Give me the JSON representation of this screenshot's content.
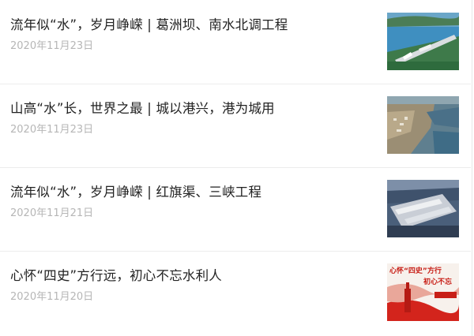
{
  "articles": [
    {
      "title": "流年似“水”，岁月峥嵘 | 葛洲坝、南水北调工程",
      "date": "2020年11月23日",
      "thumbnail": "dam-aerial-image"
    },
    {
      "title": "山高“水”长，世界之最 | 城以港兴，港为城用",
      "date": "2020年11月23日",
      "thumbnail": "coastal-city-image"
    },
    {
      "title": "流年似“水”，岁月峥嵘 | 红旗渠、三峡工程",
      "date": "2020年11月21日",
      "thumbnail": "three-gorges-dam-image"
    },
    {
      "title": "心怀“四史”方行远，初心不忘水利人",
      "date": "2020年11月20日",
      "thumbnail": "red-banner-image",
      "thumbnail_text": {
        "line1": "心怀“四史”方行",
        "line2": "初心不忘"
      }
    }
  ]
}
